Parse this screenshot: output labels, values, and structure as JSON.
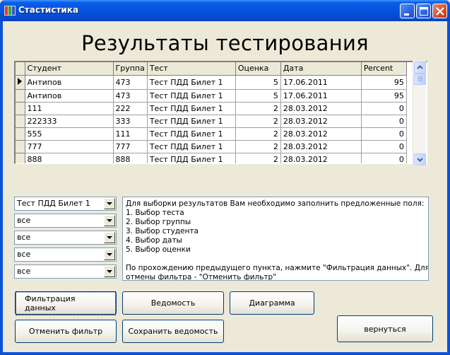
{
  "window": {
    "title": "Стастистика"
  },
  "heading": "Результаты тестирования",
  "grid": {
    "columns": [
      "Студент",
      "Группа",
      "Тест",
      "Оценка",
      "Дата",
      "Percent"
    ],
    "rows": [
      [
        "Антипов",
        "473",
        "Тест ПДД Билет 1",
        "5",
        "17.06.2011",
        "95"
      ],
      [
        "Антипов",
        "473",
        "Тест ПДД Билет 1",
        "5",
        "17.06.2011",
        "95"
      ],
      [
        "111",
        "222",
        "Тест ПДД Билет 1",
        "2",
        "28.03.2012",
        "0"
      ],
      [
        "222333",
        "333",
        "Тест ПДД Билет 1",
        "2",
        "28.03.2012",
        "0"
      ],
      [
        "555",
        "111",
        "Тест ПДД Билет 1",
        "2",
        "28.03.2012",
        "0"
      ],
      [
        "777",
        "777",
        "Тест ПДД Билет 1",
        "2",
        "28.03.2012",
        "0"
      ],
      [
        "888",
        "888",
        "Тест ПДД Билет 1",
        "2",
        "28.03.2012",
        "0"
      ]
    ]
  },
  "filters": {
    "test": "Тест ПДД Билет 1",
    "group": "все",
    "student": "все",
    "date": "все",
    "grade": "все"
  },
  "instructions": [
    "Для выборки результатов Вам необходимо заполнить предложенные поля:",
    "1. Выбор теста",
    "2. Выбор группы",
    "3. Выбор студента",
    "4. Выбор даты",
    "5. Выбор оценки",
    "",
    "По прохождению предыдущего пункта, нажмите \"Фильтрация данных\". Для",
    "отмены фильтра - \"Отменить фильтр\""
  ],
  "buttons": {
    "filter": "Фильтрация данных",
    "statement": "Ведомость",
    "chart": "Диаграмма",
    "cancel_filter": "Отменить фильтр",
    "save_statement": "Сохранить ведомость",
    "back": "вернуться"
  }
}
